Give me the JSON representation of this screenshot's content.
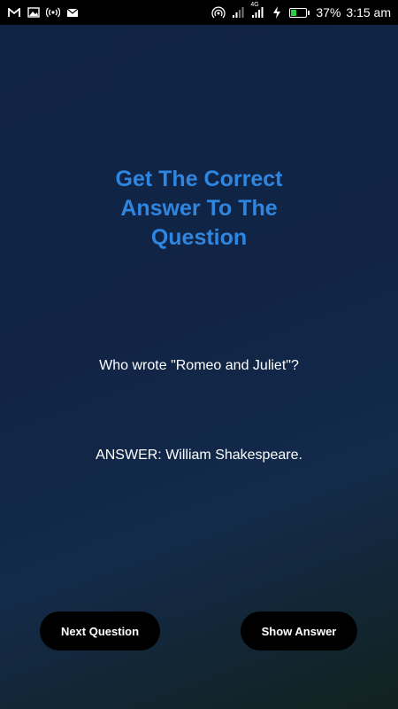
{
  "status_bar": {
    "battery": "37%",
    "time": "3:15 am",
    "network_label": "4G"
  },
  "main": {
    "title": "Get The Correct Answer To The Question",
    "question": "Who wrote \"Romeo and Juliet\"?",
    "answer": "ANSWER: William Shakespeare."
  },
  "buttons": {
    "next_label": "Next Question",
    "show_label": "Show Answer"
  },
  "colors": {
    "title": "#2e86e0",
    "button_bg": "#000000",
    "text": "#ffffff"
  }
}
